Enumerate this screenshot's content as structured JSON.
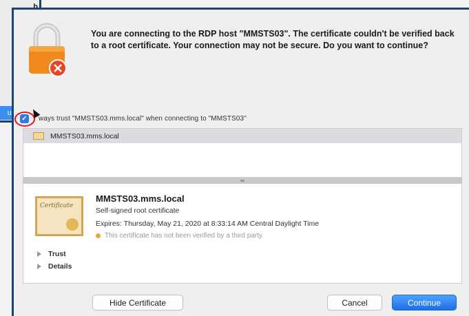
{
  "background_window": {
    "fragment_text": "b\no",
    "button_fragment": "ue"
  },
  "dialog": {
    "headline": "You are connecting to the RDP host \"MMSTS03\". The certificate couldn't be verified back to a root certificate. Your connection may not be secure. Do you want to continue?",
    "always_trust_label": "ways trust \"MMSTS03.mms.local\" when connecting to \"MMSTS03\"",
    "always_trust_checked": true,
    "cert_list_item": "MMSTS03.mms.local",
    "cert": {
      "name": "MMSTS03.mms.local",
      "subtitle": "Self-signed root certificate",
      "expires": "Expires: Thursday, May 21, 2020 at 8:33:14 AM Central Daylight Time",
      "warning": "This certificate has not been verified by a third party",
      "image_word": "Certificate"
    },
    "disclosures": [
      "Trust",
      "Details"
    ],
    "buttons": {
      "hide_certificate": "Hide Certificate",
      "cancel": "Cancel",
      "continue": "Continue"
    }
  },
  "colors": {
    "frame_border": "#1b4478",
    "accent_blue": "#2f7ae0",
    "highlight_circle": "#e0141e",
    "lock_orange": "#f08a1c"
  },
  "icons": [
    "lock-icon",
    "warning-icon",
    "certificate-icon",
    "checkbox-checked-icon",
    "cursor-icon"
  ]
}
